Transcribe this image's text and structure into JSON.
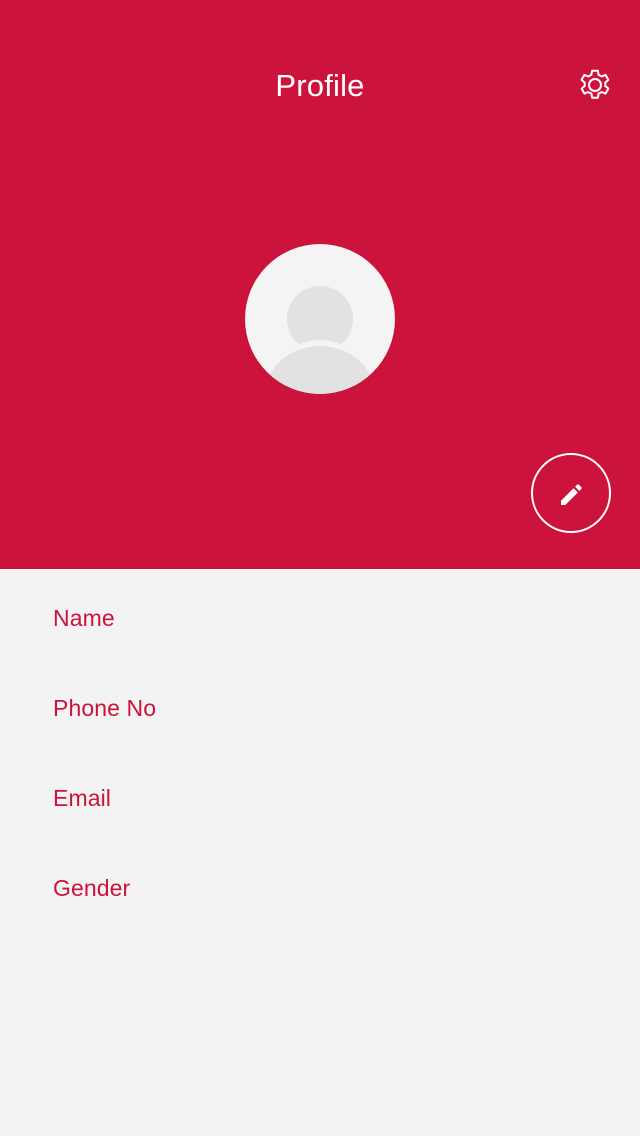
{
  "colors": {
    "primary": "#cc133b",
    "header_bg": "#cc133b",
    "page_bg": "#f3f3f3",
    "header_text": "#ffffff",
    "field_label": "#cc133b",
    "avatar_bg": "#f4f4f4",
    "avatar_silhouette": "#e2e2e2"
  },
  "header": {
    "title": "Profile",
    "settings_icon": "gear-icon"
  },
  "avatar": {
    "icon": "default-user-avatar-icon"
  },
  "edit_button": {
    "icon": "pencil-icon"
  },
  "profile_fields": {
    "name_label": "Name",
    "phone_label": "Phone No",
    "email_label": "Email",
    "gender_label": "Gender"
  }
}
